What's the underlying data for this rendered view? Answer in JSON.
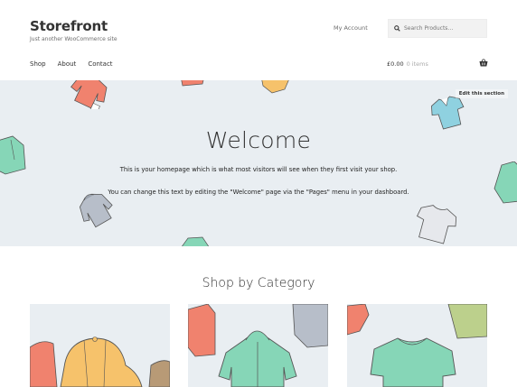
{
  "header": {
    "site_title": "Storefront",
    "tagline": "Just another WooCommerce site",
    "my_account": "My Account",
    "search_placeholder": "Search Products…"
  },
  "nav": {
    "items": [
      {
        "label": "Shop"
      },
      {
        "label": "About"
      },
      {
        "label": "Contact"
      }
    ]
  },
  "cart": {
    "total": "£0.00",
    "items": "0 items"
  },
  "hero": {
    "edit_label": "Edit this section",
    "title": "Welcome",
    "line1": "This is your homepage which is what most visitors will see when they first visit your shop.",
    "line2": "You can change this text by editing the \"Welcome\" page via the \"Pages\" menu in your dashboard."
  },
  "shop": {
    "title": "Shop by Category"
  },
  "colors": {
    "accent": "#96588a",
    "hero_bg": "#e9eef2",
    "garment_coral": "#f0826e",
    "garment_yellow": "#f6c26b",
    "garment_mint": "#86d6b7",
    "garment_blue": "#8fd1e0",
    "garment_grey": "#b7bec9",
    "garment_olive": "#bcd08c"
  }
}
